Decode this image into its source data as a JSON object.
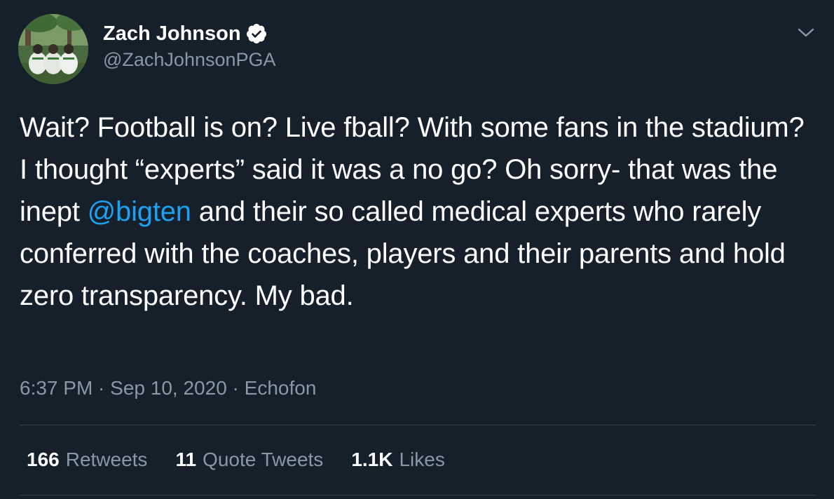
{
  "author": {
    "display_name": "Zach Johnson",
    "handle": "@ZachJohnsonPGA",
    "verified": true
  },
  "tweet": {
    "text_before_mention": "Wait? Football is on? Live fball? With some fans in the stadium? I thought “experts” said it was a no go? Oh sorry- that was the inept ",
    "mention": "@bigten",
    "text_after_mention": " and their so called medical experts who rarely conferred with the coaches, players and their parents and hold zero transparency. My bad."
  },
  "meta": {
    "time": "6:37 PM",
    "separator": " · ",
    "date": "Sep 10, 2020",
    "app": "Echofon"
  },
  "stats": {
    "retweets": {
      "count": "166",
      "label": "Retweets"
    },
    "quote_tweets": {
      "count": "11",
      "label": "Quote Tweets"
    },
    "likes": {
      "count": "1.1K",
      "label": "Likes"
    }
  },
  "colors": {
    "background": "#15202b",
    "mention": "#1da1f2",
    "secondary_text": "#8899a6",
    "divider": "#38444d"
  },
  "icons": {
    "verified": "verified-badge-icon",
    "more": "chevron-down-icon"
  }
}
